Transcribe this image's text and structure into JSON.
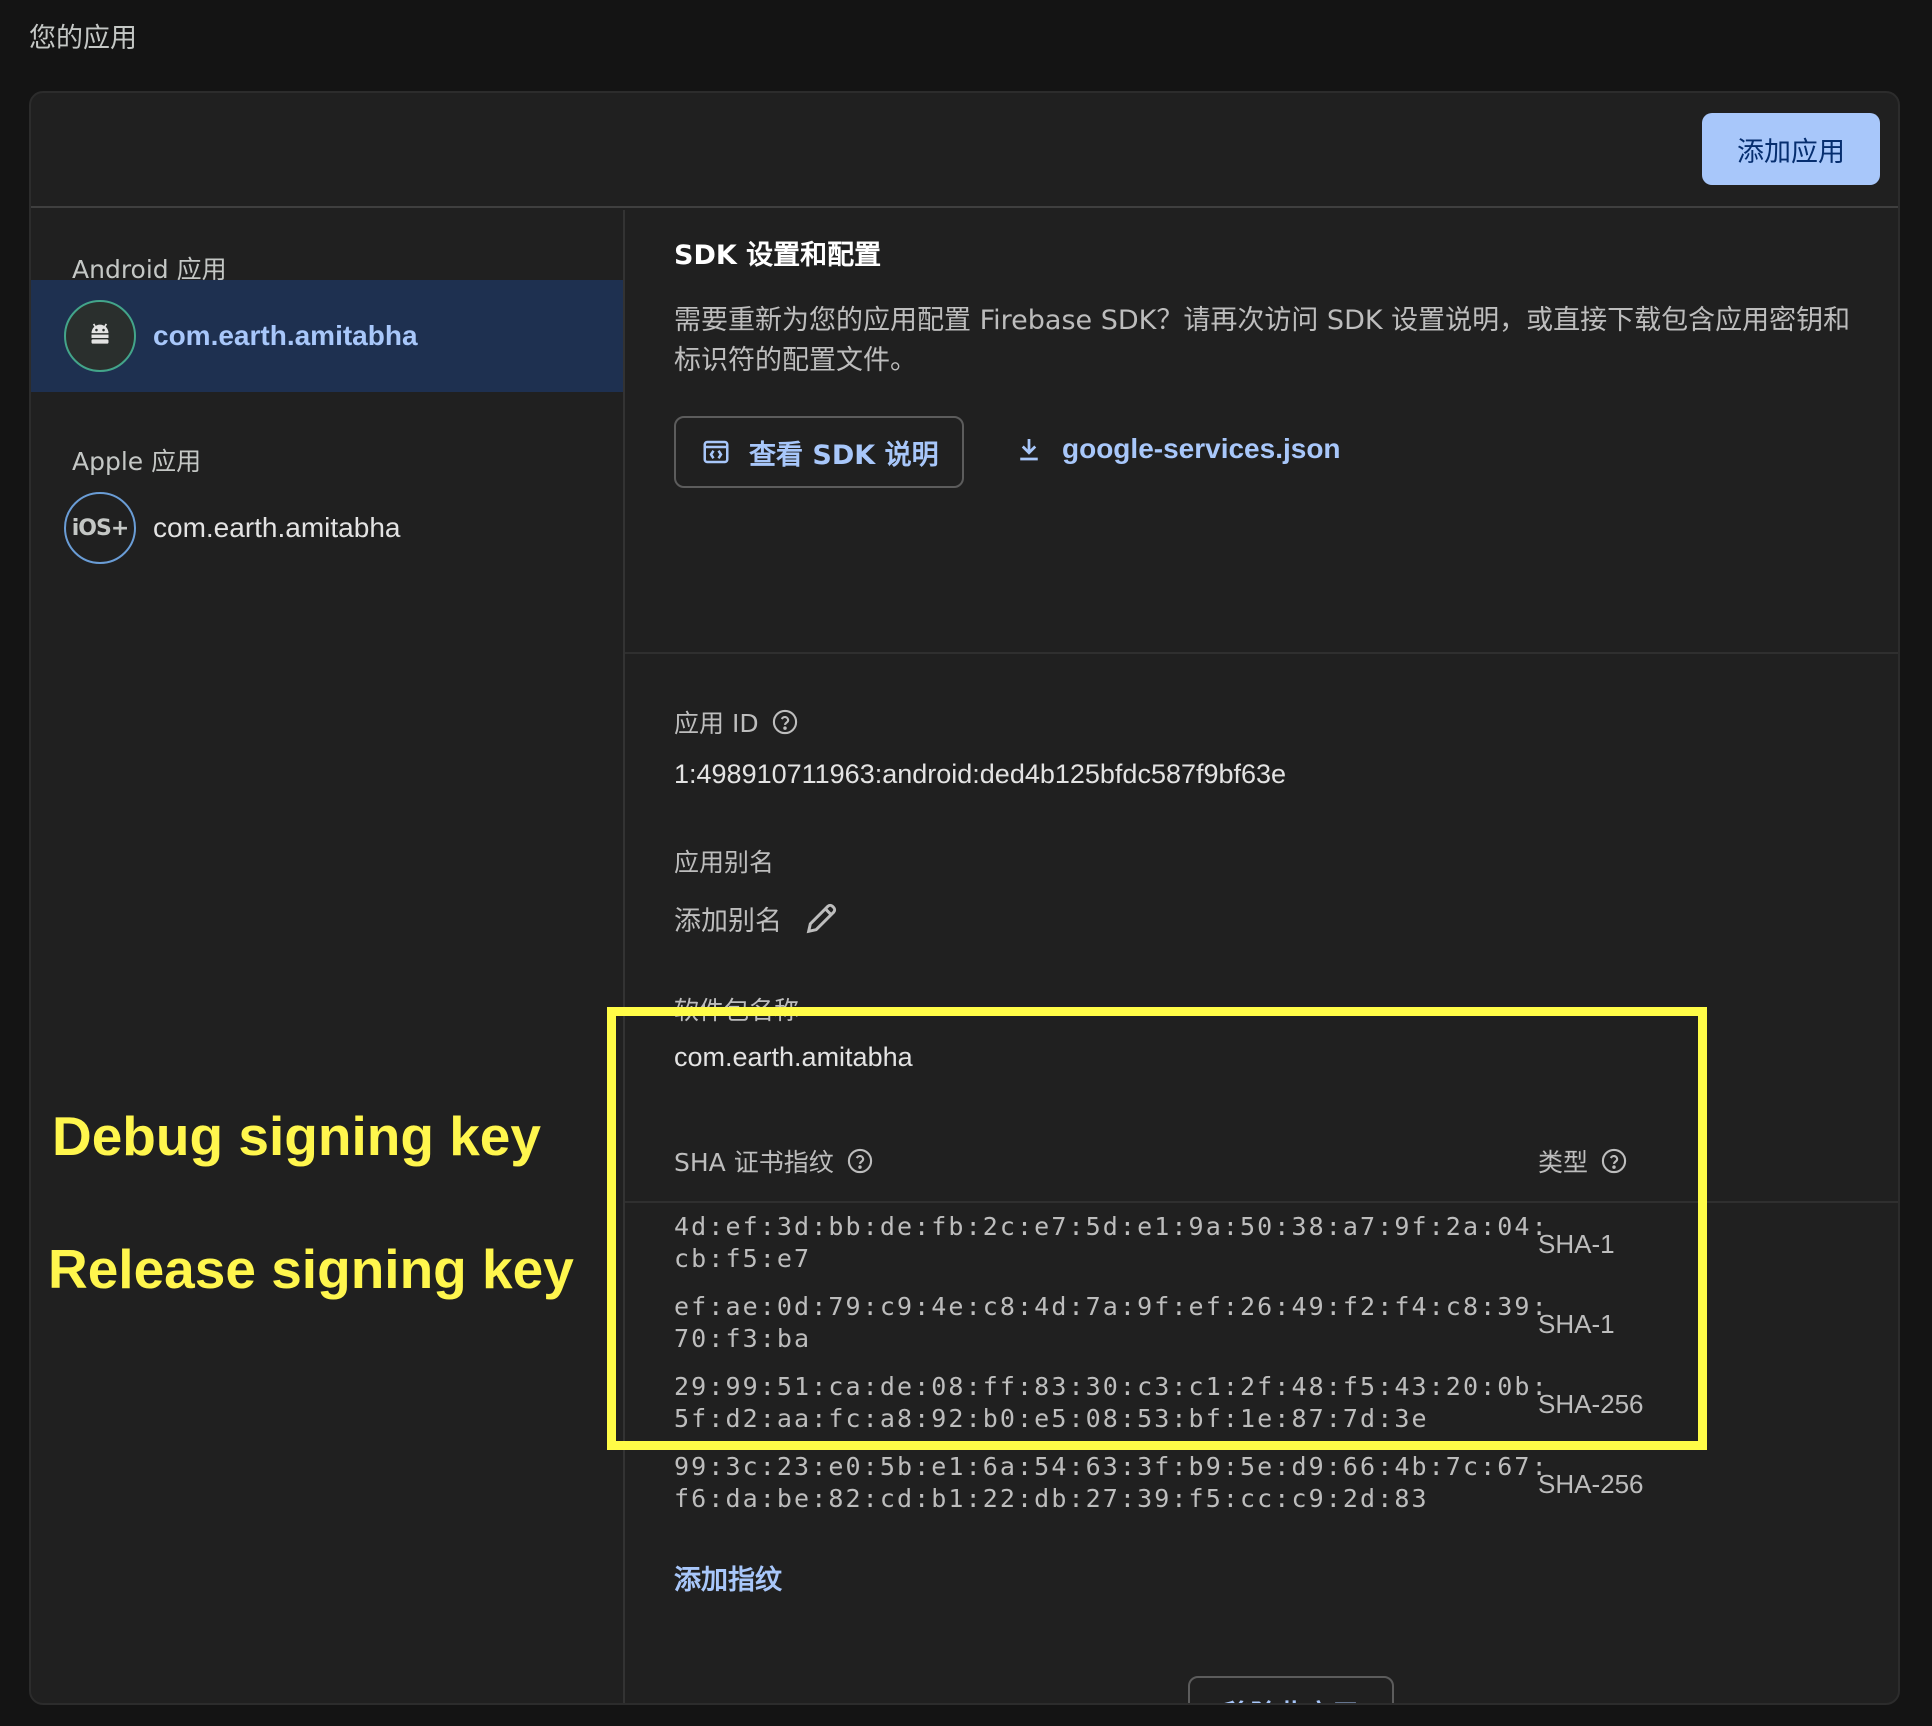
{
  "page_title": "您的应用",
  "header": {
    "add_app_label": "添加应用"
  },
  "sidebar": {
    "android_section": "Android 应用",
    "apple_section": "Apple 应用",
    "android_app": "com.earth.amitabha",
    "apple_app": "com.earth.amitabha",
    "ios_badge": "iOS+"
  },
  "sdk": {
    "title": "SDK 设置和配置",
    "description": "需要重新为您的应用配置 Firebase SDK？请再次访问 SDK 设置说明，或直接下载包含应用密钥和标识符的配置文件。",
    "view_button": "查看 SDK 说明",
    "download_link": "google-services.json"
  },
  "fields": {
    "app_id_label": "应用 ID",
    "app_id_value": "1:498910711963:android:ded4b125bfdc587f9bf63e",
    "alias_label": "应用别名",
    "alias_placeholder": "添加别名",
    "package_label": "软件包名称",
    "package_value": "com.earth.amitabha"
  },
  "sha": {
    "fingerprint_header": "SHA 证书指纹",
    "type_header": "类型",
    "rows": [
      {
        "fingerprint": "4d:ef:3d:bb:de:fb:2c:e7:5d:e1:9a:50:38:a7:9f:2a:04:\ncb:f5:e7",
        "type": "SHA-1"
      },
      {
        "fingerprint": "ef:ae:0d:79:c9:4e:c8:4d:7a:9f:ef:26:49:f2:f4:c8:39:\n70:f3:ba",
        "type": "SHA-1"
      },
      {
        "fingerprint": "29:99:51:ca:de:08:ff:83:30:c3:c1:2f:48:f5:43:20:0b:\n5f:d2:aa:fc:a8:92:b0:e5:08:53:bf:1e:87:7d:3e",
        "type": "SHA-256"
      },
      {
        "fingerprint": "99:3c:23:e0:5b:e1:6a:54:63:3f:b9:5e:d9:66:4b:7c:67:\nf6:da:be:82:cd:b1:22:db:27:39:f5:cc:c9:2d:83",
        "type": "SHA-256"
      }
    ],
    "add_fingerprint": "添加指纹"
  },
  "remove_app": "移除此应用",
  "annotations": {
    "debug": "Debug signing key",
    "release": "Release signing key"
  },
  "colors": {
    "accent": "#a8c7fa",
    "highlight": "#fffc47",
    "selected_bg": "#1e3050"
  }
}
